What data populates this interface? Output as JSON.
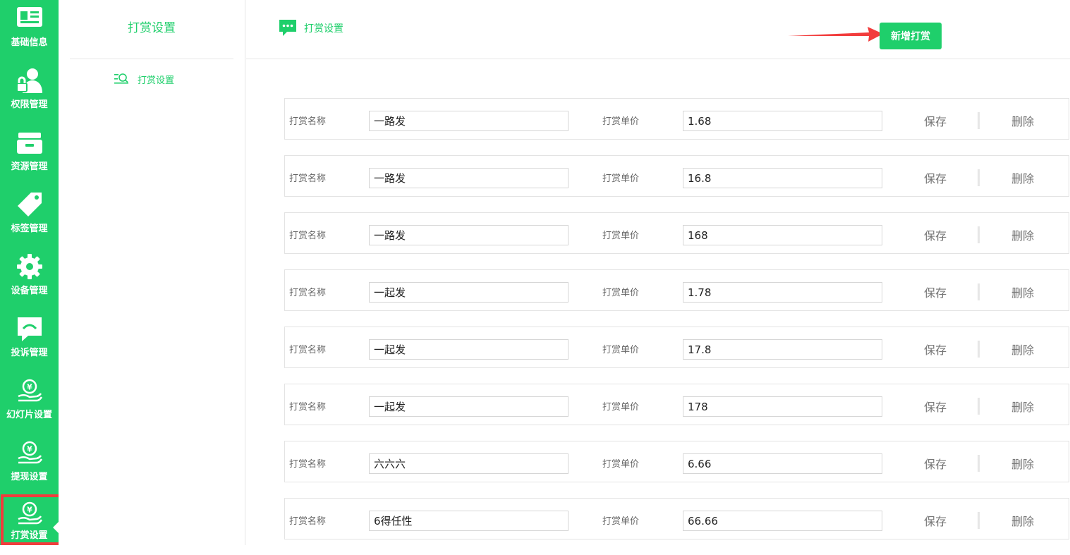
{
  "sidebar": {
    "items": [
      {
        "label": "基础信息",
        "icon": "id-card-icon"
      },
      {
        "label": "权限管理",
        "icon": "user-lock-icon"
      },
      {
        "label": "资源管理",
        "icon": "drawer-icon"
      },
      {
        "label": "标签管理",
        "icon": "tag-icon"
      },
      {
        "label": "设备管理",
        "icon": "gear-icon"
      },
      {
        "label": "投诉管理",
        "icon": "chat-bubble-icon"
      },
      {
        "label": "幻灯片设置",
        "icon": "hand-coin-icon"
      },
      {
        "label": "提现设置",
        "icon": "hand-coin-icon"
      },
      {
        "label": "打赏设置",
        "icon": "hand-coin-icon",
        "active": true
      }
    ]
  },
  "submenu": {
    "title": "打赏设置",
    "items": [
      {
        "label": "打赏设置",
        "icon": "search-list-icon"
      }
    ]
  },
  "header": {
    "title": "打赏设置",
    "icon": "message-dots-icon",
    "add_button": "新增打赏"
  },
  "row_labels": {
    "name": "打赏名称",
    "price": "打赏单价",
    "save": "保存",
    "delete": "删除"
  },
  "rewards": [
    {
      "name": "一路发",
      "price": "1.68"
    },
    {
      "name": "一路发",
      "price": "16.8"
    },
    {
      "name": "一路发",
      "price": "168"
    },
    {
      "name": "一起发",
      "price": "1.78"
    },
    {
      "name": "一起发",
      "price": "17.8"
    },
    {
      "name": "一起发",
      "price": "178"
    },
    {
      "name": "六六六",
      "price": "6.66"
    },
    {
      "name": "6得任性",
      "price": "66.66"
    }
  ],
  "colors": {
    "accent": "#1fcf6b",
    "highlight": "#f23c3c"
  }
}
